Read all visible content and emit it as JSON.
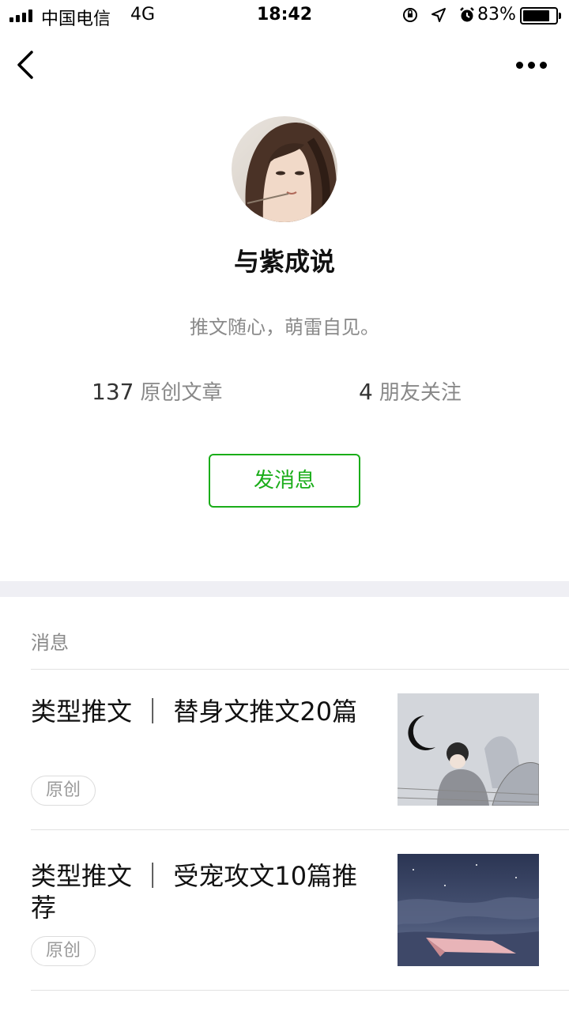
{
  "status_bar": {
    "carrier": "中国电信",
    "network": "4G",
    "time": "18:42",
    "battery": "83%",
    "battery_level": 0.83
  },
  "profile": {
    "name": "与紫成说",
    "bio": "推文随心，萌雷自见。",
    "articles_count": "137",
    "articles_label": "原创文章",
    "friends_count": "4",
    "friends_label": "朋友关注",
    "message_button": "发消息"
  },
  "section_label": "消息",
  "articles": [
    {
      "title": "类型推文 ｜ 替身文推文20篇",
      "tag": "原创"
    },
    {
      "title": "类型推文 ｜ 受宠攻文10篇推荐",
      "tag": "原创"
    }
  ],
  "colors": {
    "accent": "#1aad19",
    "separator": "#efeff4"
  },
  "icons": [
    "signal-icon",
    "orientation-lock-icon",
    "location-arrow-icon",
    "alarm-icon",
    "battery-icon",
    "back-arrow-icon",
    "more-dots-icon"
  ]
}
